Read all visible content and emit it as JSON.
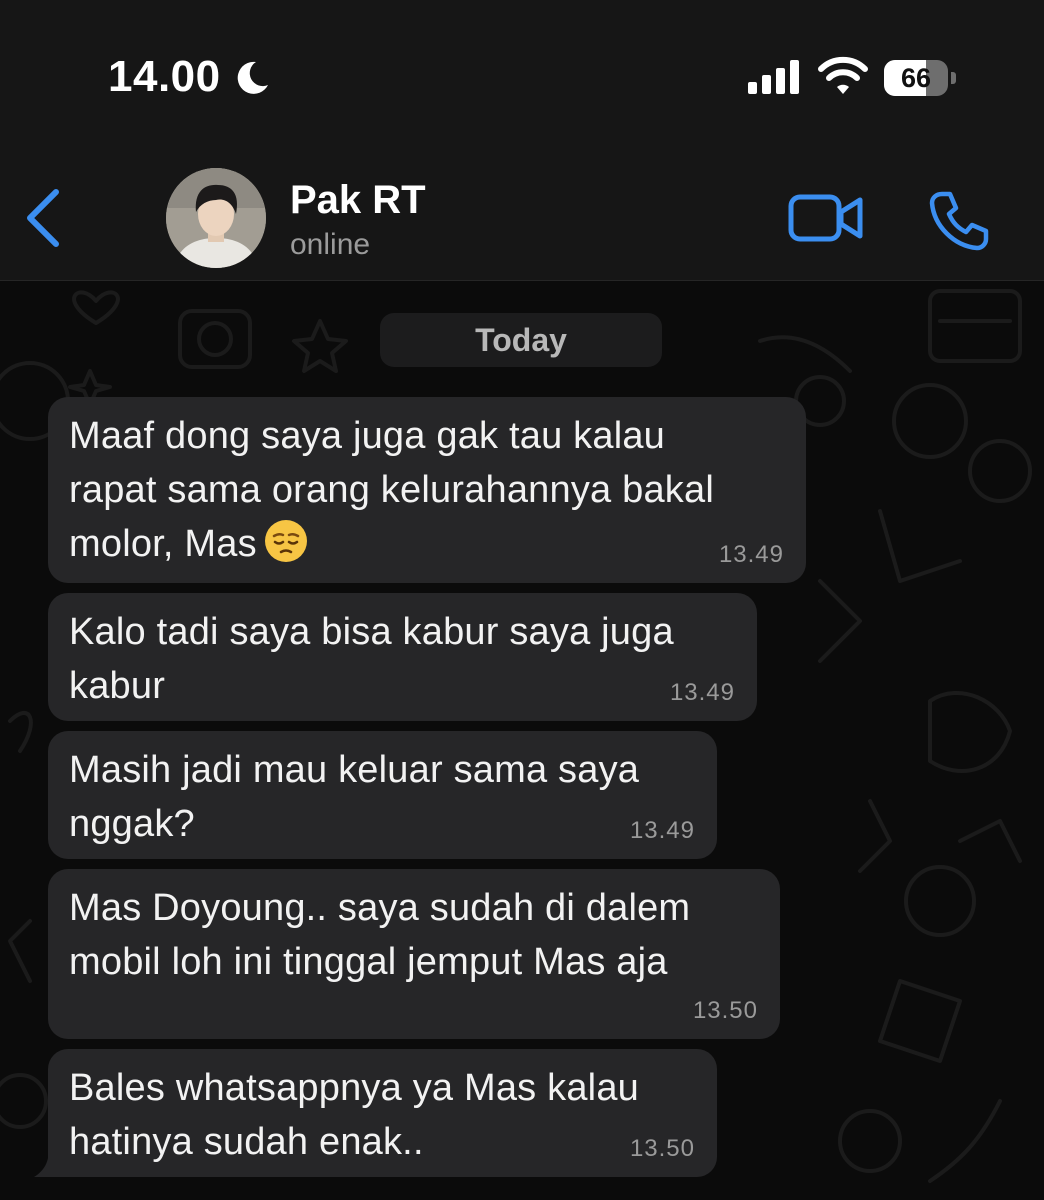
{
  "status_bar": {
    "time": "14.00",
    "battery_level": "66",
    "battery_fraction": 0.66,
    "icons": [
      "moon-icon",
      "signal-icon",
      "wifi-icon",
      "battery-icon"
    ]
  },
  "header": {
    "contact_name": "Pak RT",
    "contact_status": "online",
    "accent_color": "#3b8ef0",
    "icons": [
      "back-chevron-icon",
      "video-camera-icon",
      "phone-icon"
    ]
  },
  "chat": {
    "date_label": "Today",
    "bubble_color": "#262628",
    "messages": [
      {
        "text": "Maaf dong saya juga gak tau kalau\nrapat sama orang kelurahannya bakal\nmolor, Mas",
        "emoji": "pensive-face",
        "time": "13.49"
      },
      {
        "text": "Kalo tadi saya bisa kabur saya juga\nkabur",
        "time": "13.49"
      },
      {
        "text": "Masih jadi mau keluar sama saya\nnggak?",
        "time": "13.49"
      },
      {
        "text": "Mas Doyoung.. saya sudah di dalem\nmobil loh ini tinggal jemput Mas aja",
        "time": "13.50"
      },
      {
        "text": "Bales whatsappnya ya Mas kalau\nhatinya sudah enak..",
        "time": "13.50"
      }
    ]
  }
}
